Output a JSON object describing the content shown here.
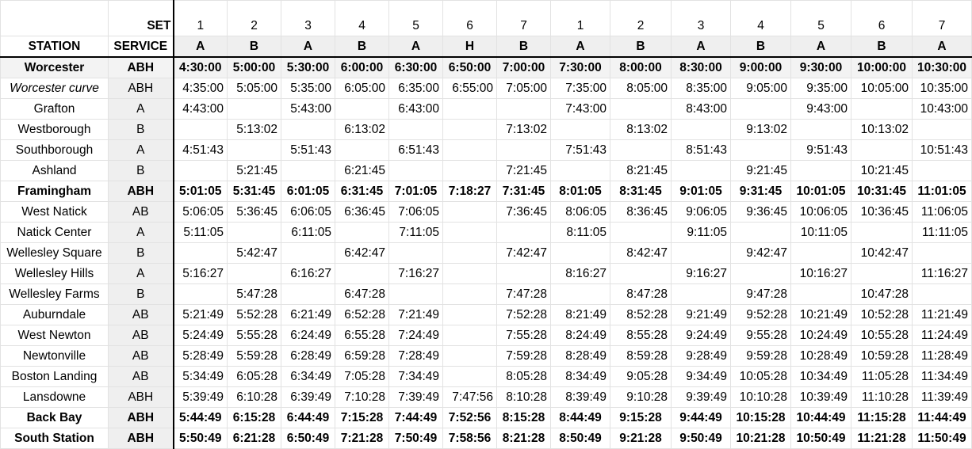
{
  "header": {
    "set_label": "SET",
    "station_label": "STATION",
    "service_label": "SERVICE",
    "sets": [
      "1",
      "2",
      "3",
      "4",
      "5",
      "6",
      "7",
      "1",
      "2",
      "3",
      "4",
      "5",
      "6",
      "7"
    ],
    "services": [
      "A",
      "B",
      "A",
      "B",
      "A",
      "H",
      "B",
      "A",
      "B",
      "A",
      "B",
      "A",
      "B",
      "A"
    ]
  },
  "rows": [
    {
      "station": "Worcester",
      "service": "ABH",
      "style": "bold",
      "shaded": true,
      "times": [
        "4:30:00",
        "5:00:00",
        "5:30:00",
        "6:00:00",
        "6:30:00",
        "6:50:00",
        "7:00:00",
        "7:30:00",
        "8:00:00",
        "8:30:00",
        "9:00:00",
        "9:30:00",
        "10:00:00",
        "10:30:00"
      ]
    },
    {
      "station": "Worcester curve",
      "service": "ABH",
      "style": "italic",
      "times": [
        "4:35:00",
        "5:05:00",
        "5:35:00",
        "6:05:00",
        "6:35:00",
        "6:55:00",
        "7:05:00",
        "7:35:00",
        "8:05:00",
        "8:35:00",
        "9:05:00",
        "9:35:00",
        "10:05:00",
        "10:35:00"
      ]
    },
    {
      "station": "Grafton",
      "service": "A",
      "times": [
        "4:43:00",
        "",
        "5:43:00",
        "",
        "6:43:00",
        "",
        "",
        "7:43:00",
        "",
        "8:43:00",
        "",
        "9:43:00",
        "",
        "10:43:00"
      ]
    },
    {
      "station": "Westborough",
      "service": "B",
      "times": [
        "",
        "5:13:02",
        "",
        "6:13:02",
        "",
        "",
        "7:13:02",
        "",
        "8:13:02",
        "",
        "9:13:02",
        "",
        "10:13:02",
        ""
      ]
    },
    {
      "station": "Southborough",
      "service": "A",
      "times": [
        "4:51:43",
        "",
        "5:51:43",
        "",
        "6:51:43",
        "",
        "",
        "7:51:43",
        "",
        "8:51:43",
        "",
        "9:51:43",
        "",
        "10:51:43"
      ]
    },
    {
      "station": "Ashland",
      "service": "B",
      "times": [
        "",
        "5:21:45",
        "",
        "6:21:45",
        "",
        "",
        "7:21:45",
        "",
        "8:21:45",
        "",
        "9:21:45",
        "",
        "10:21:45",
        ""
      ]
    },
    {
      "station": "Framingham",
      "service": "ABH",
      "style": "bold",
      "times": [
        "5:01:05",
        "5:31:45",
        "6:01:05",
        "6:31:45",
        "7:01:05",
        "7:18:27",
        "7:31:45",
        "8:01:05",
        "8:31:45",
        "9:01:05",
        "9:31:45",
        "10:01:05",
        "10:31:45",
        "11:01:05"
      ]
    },
    {
      "station": "West Natick",
      "service": "AB",
      "times": [
        "5:06:05",
        "5:36:45",
        "6:06:05",
        "6:36:45",
        "7:06:05",
        "",
        "7:36:45",
        "8:06:05",
        "8:36:45",
        "9:06:05",
        "9:36:45",
        "10:06:05",
        "10:36:45",
        "11:06:05"
      ]
    },
    {
      "station": "Natick Center",
      "service": "A",
      "times": [
        "5:11:05",
        "",
        "6:11:05",
        "",
        "7:11:05",
        "",
        "",
        "8:11:05",
        "",
        "9:11:05",
        "",
        "10:11:05",
        "",
        "11:11:05"
      ]
    },
    {
      "station": "Wellesley Square",
      "service": "B",
      "times": [
        "",
        "5:42:47",
        "",
        "6:42:47",
        "",
        "",
        "7:42:47",
        "",
        "8:42:47",
        "",
        "9:42:47",
        "",
        "10:42:47",
        ""
      ]
    },
    {
      "station": "Wellesley Hills",
      "service": "A",
      "times": [
        "5:16:27",
        "",
        "6:16:27",
        "",
        "7:16:27",
        "",
        "",
        "8:16:27",
        "",
        "9:16:27",
        "",
        "10:16:27",
        "",
        "11:16:27"
      ]
    },
    {
      "station": "Wellesley Farms",
      "service": "B",
      "times": [
        "",
        "5:47:28",
        "",
        "6:47:28",
        "",
        "",
        "7:47:28",
        "",
        "8:47:28",
        "",
        "9:47:28",
        "",
        "10:47:28",
        ""
      ]
    },
    {
      "station": "Auburndale",
      "service": "AB",
      "times": [
        "5:21:49",
        "5:52:28",
        "6:21:49",
        "6:52:28",
        "7:21:49",
        "",
        "7:52:28",
        "8:21:49",
        "8:52:28",
        "9:21:49",
        "9:52:28",
        "10:21:49",
        "10:52:28",
        "11:21:49"
      ]
    },
    {
      "station": "West Newton",
      "service": "AB",
      "times": [
        "5:24:49",
        "5:55:28",
        "6:24:49",
        "6:55:28",
        "7:24:49",
        "",
        "7:55:28",
        "8:24:49",
        "8:55:28",
        "9:24:49",
        "9:55:28",
        "10:24:49",
        "10:55:28",
        "11:24:49"
      ]
    },
    {
      "station": "Newtonville",
      "service": "AB",
      "times": [
        "5:28:49",
        "5:59:28",
        "6:28:49",
        "6:59:28",
        "7:28:49",
        "",
        "7:59:28",
        "8:28:49",
        "8:59:28",
        "9:28:49",
        "9:59:28",
        "10:28:49",
        "10:59:28",
        "11:28:49"
      ]
    },
    {
      "station": "Boston Landing",
      "service": "AB",
      "times": [
        "5:34:49",
        "6:05:28",
        "6:34:49",
        "7:05:28",
        "7:34:49",
        "",
        "8:05:28",
        "8:34:49",
        "9:05:28",
        "9:34:49",
        "10:05:28",
        "10:34:49",
        "11:05:28",
        "11:34:49"
      ]
    },
    {
      "station": "Lansdowne",
      "service": "ABH",
      "times": [
        "5:39:49",
        "6:10:28",
        "6:39:49",
        "7:10:28",
        "7:39:49",
        "7:47:56",
        "8:10:28",
        "8:39:49",
        "9:10:28",
        "9:39:49",
        "10:10:28",
        "10:39:49",
        "11:10:28",
        "11:39:49"
      ]
    },
    {
      "station": "Back Bay",
      "service": "ABH",
      "style": "bold",
      "times": [
        "5:44:49",
        "6:15:28",
        "6:44:49",
        "7:15:28",
        "7:44:49",
        "7:52:56",
        "8:15:28",
        "8:44:49",
        "9:15:28",
        "9:44:49",
        "10:15:28",
        "10:44:49",
        "11:15:28",
        "11:44:49"
      ]
    },
    {
      "station": "South Station",
      "service": "ABH",
      "style": "bold",
      "times": [
        "5:50:49",
        "6:21:28",
        "6:50:49",
        "7:21:28",
        "7:50:49",
        "7:58:56",
        "8:21:28",
        "8:50:49",
        "9:21:28",
        "9:50:49",
        "10:21:28",
        "10:50:49",
        "11:21:28",
        "11:50:49"
      ]
    }
  ]
}
